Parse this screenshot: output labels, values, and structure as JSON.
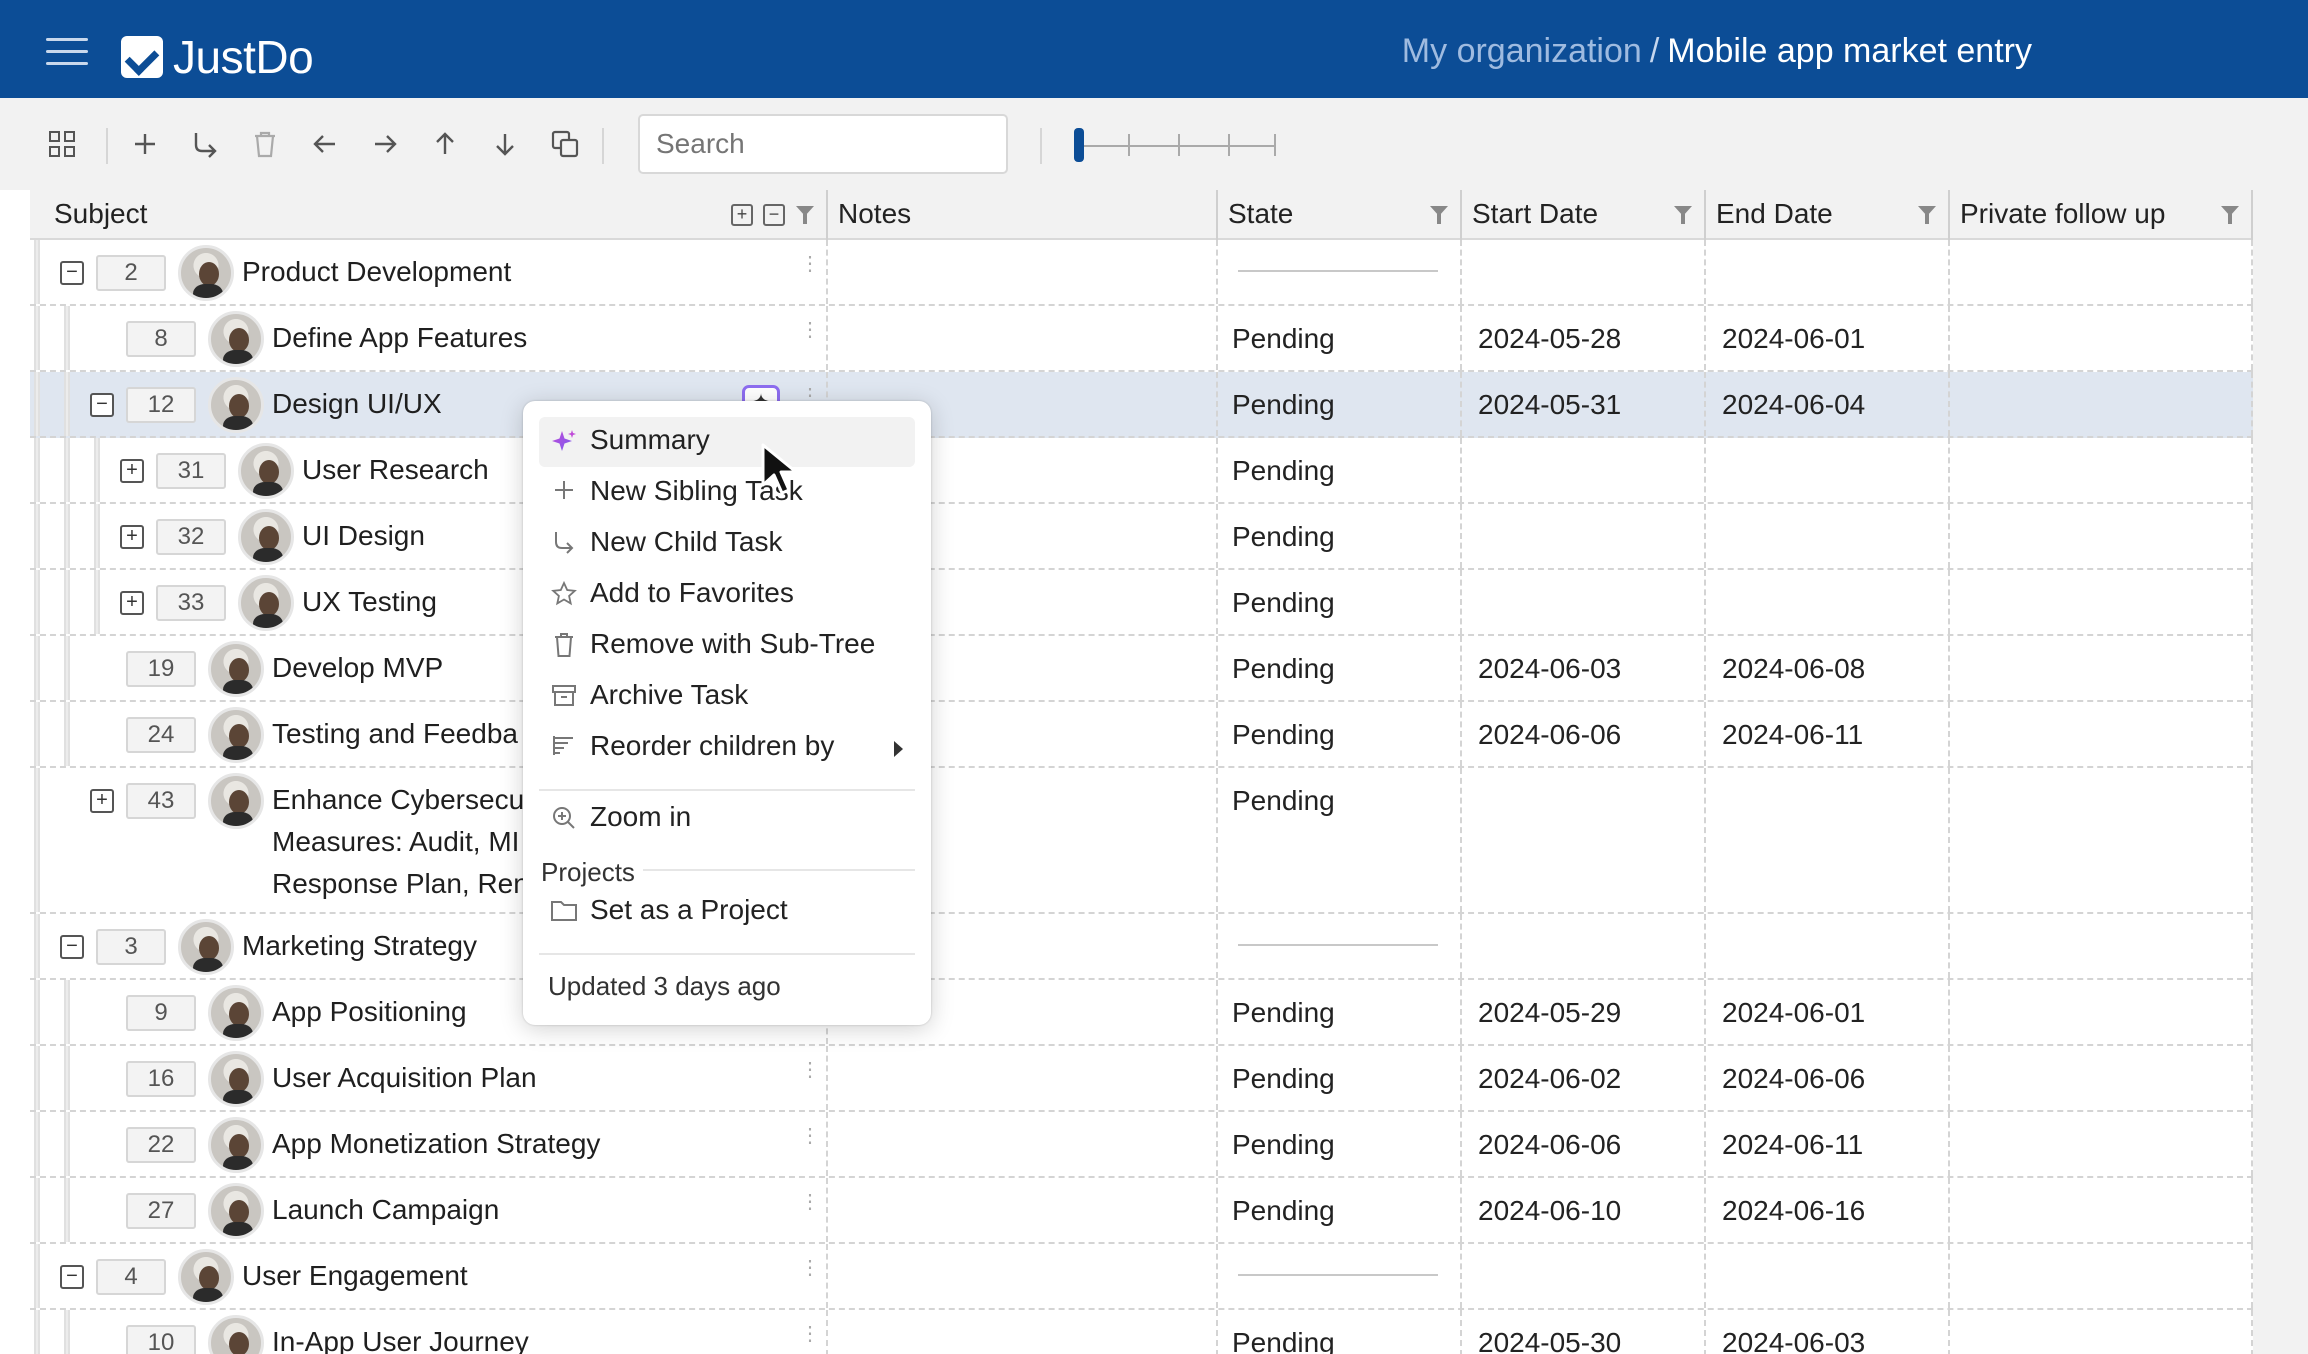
{
  "header": {
    "app_name": "JustDo",
    "org": "My organization",
    "separator": "/",
    "project": "Mobile app market entry"
  },
  "toolbar": {
    "search_placeholder": "Search"
  },
  "columns": {
    "subject": "Subject",
    "notes": "Notes",
    "state": "State",
    "start_date": "Start Date",
    "end_date": "End Date",
    "private_follow_up": "Private follow up"
  },
  "rows": [
    {
      "num": "2",
      "subject": "Product Development",
      "state": "",
      "start": "",
      "end": "",
      "toggle": "−"
    },
    {
      "num": "8",
      "subject": "Define App Features",
      "state": "Pending",
      "start": "2024-05-28",
      "end": "2024-06-01"
    },
    {
      "num": "12",
      "subject": "Design UI/UX",
      "state": "Pending",
      "start": "2024-05-31",
      "end": "2024-06-04",
      "toggle": "−"
    },
    {
      "num": "31",
      "subject": "User Research",
      "state": "Pending",
      "start": "",
      "end": "",
      "toggle": "+"
    },
    {
      "num": "32",
      "subject": "UI Design",
      "state": "Pending",
      "start": "",
      "end": "",
      "toggle": "+"
    },
    {
      "num": "33",
      "subject": "UX Testing",
      "state": "Pending",
      "start": "",
      "end": "",
      "toggle": "+"
    },
    {
      "num": "19",
      "subject": "Develop MVP",
      "state": "Pending",
      "start": "2024-06-03",
      "end": "2024-06-08"
    },
    {
      "num": "24",
      "subject": "Testing and Feedba",
      "state": "Pending",
      "start": "2024-06-06",
      "end": "2024-06-11"
    },
    {
      "num": "43",
      "subject_lines": [
        "Enhance Cybersecu",
        "Measures: Audit, MI",
        "Response Plan, Ren"
      ],
      "state": "Pending",
      "start": "",
      "end": "",
      "toggle": "+"
    },
    {
      "num": "3",
      "subject": "Marketing Strategy",
      "state": "",
      "start": "",
      "end": "",
      "toggle": "−"
    },
    {
      "num": "9",
      "subject": "App Positioning",
      "state": "Pending",
      "start": "2024-05-29",
      "end": "2024-06-01"
    },
    {
      "num": "16",
      "subject": "User Acquisition Plan",
      "state": "Pending",
      "start": "2024-06-02",
      "end": "2024-06-06"
    },
    {
      "num": "22",
      "subject": "App Monetization Strategy",
      "state": "Pending",
      "start": "2024-06-06",
      "end": "2024-06-11"
    },
    {
      "num": "27",
      "subject": "Launch Campaign",
      "state": "Pending",
      "start": "2024-06-10",
      "end": "2024-06-16"
    },
    {
      "num": "4",
      "subject": "User Engagement",
      "state": "",
      "start": "",
      "end": "",
      "toggle": "−"
    },
    {
      "num": "10",
      "subject": "In-App User Journey",
      "state": "Pending",
      "start": "2024-05-30",
      "end": "2024-06-03"
    }
  ],
  "context_menu": {
    "items": [
      {
        "label": "Summary",
        "icon": "sparkle-icon"
      },
      {
        "label": "New Sibling Task",
        "icon": "plus-icon"
      },
      {
        "label": "New Child Task",
        "icon": "child-arrow-icon"
      },
      {
        "label": "Add to Favorites",
        "icon": "star-icon"
      },
      {
        "label": "Remove with Sub-Tree",
        "icon": "trash-icon"
      },
      {
        "label": "Archive Task",
        "icon": "archive-icon"
      },
      {
        "label": "Reorder children by",
        "icon": "sort-icon"
      },
      {
        "label": "Zoom in",
        "icon": "zoom-in-icon"
      },
      {
        "label": "Set as a Project",
        "icon": "folder-icon"
      }
    ],
    "section_projects": "Projects",
    "footer": "Updated 3 days ago"
  }
}
